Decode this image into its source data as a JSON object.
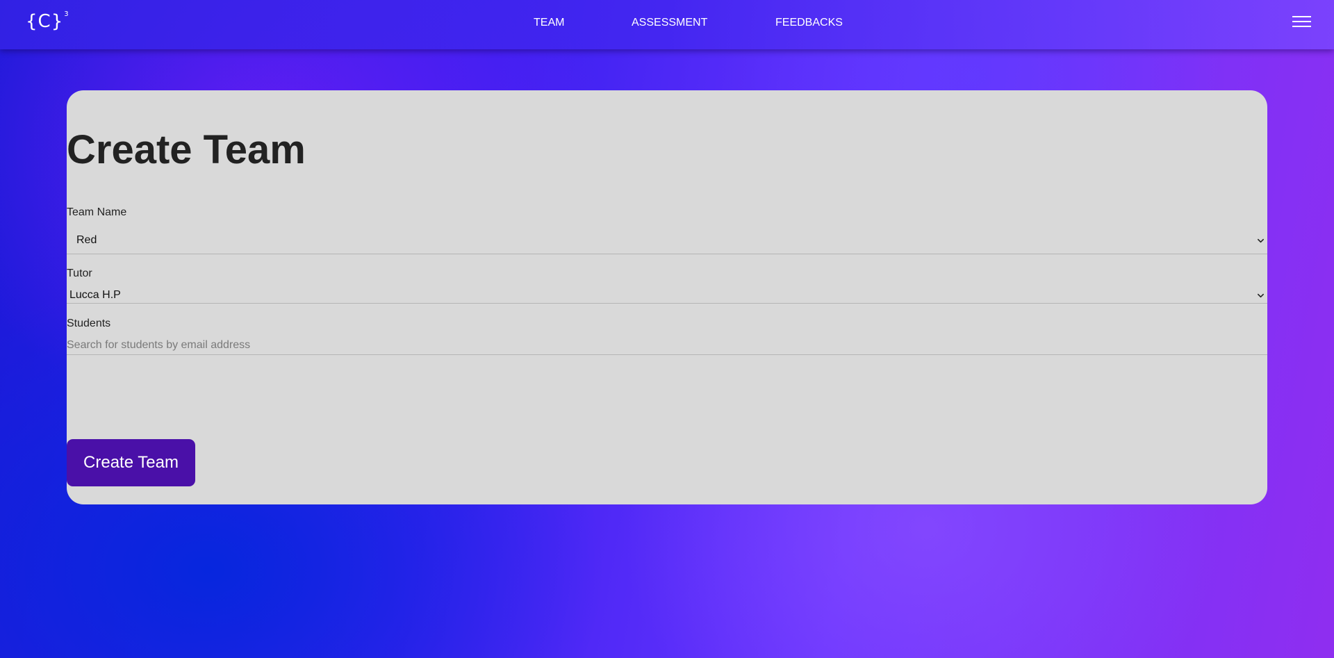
{
  "header": {
    "logo": {
      "text": "{C}",
      "superscript": "3"
    },
    "nav": [
      {
        "label": "TEAM"
      },
      {
        "label": "ASSESSMENT"
      },
      {
        "label": "FEEDBACKS"
      }
    ],
    "menu_icon": "hamburger-menu-icon"
  },
  "form": {
    "title": "Create Team",
    "team_name": {
      "label": "Team Name",
      "value": "Red"
    },
    "tutor": {
      "label": "Tutor",
      "value": "Lucca H.P"
    },
    "students": {
      "label": "Students",
      "placeholder": "Search for students by email address",
      "value": ""
    },
    "submit_label": "Create Team"
  },
  "colors": {
    "card_background": "#d9d9d9",
    "button_background": "#4a10a8",
    "text": "#222222"
  }
}
